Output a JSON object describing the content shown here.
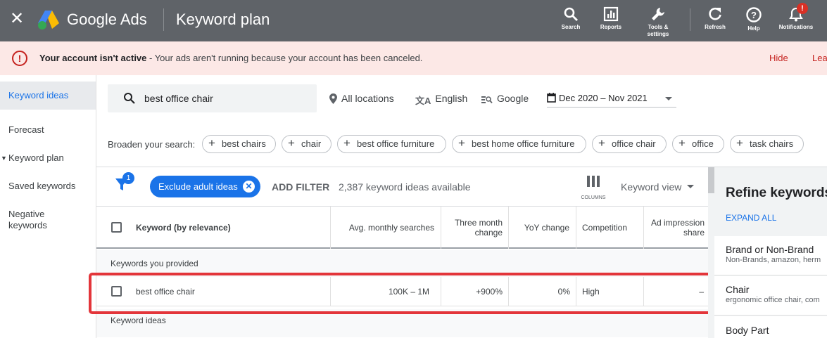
{
  "topbar": {
    "brand": "Google Ads",
    "page_title": "Keyword plan",
    "actions": [
      {
        "label": "Search",
        "icon": "search-icon"
      },
      {
        "label": "Reports",
        "icon": "reports-icon"
      },
      {
        "label": "Tools & settings",
        "icon": "wrench-icon"
      },
      {
        "label": "Refresh",
        "icon": "refresh-icon"
      },
      {
        "label": "Help",
        "icon": "help-icon"
      },
      {
        "label": "Notifications",
        "icon": "bell-icon",
        "badge": "!"
      }
    ]
  },
  "alert": {
    "title": "Your account isn't active",
    "message": " - Your ads aren't running because your account has been canceled.",
    "hide": "Hide",
    "learn": "Lea"
  },
  "sidebar": {
    "items": [
      {
        "label": "Keyword ideas",
        "active": true
      },
      {
        "label": "Forecast"
      },
      {
        "label": "Keyword plan",
        "expandable": true
      },
      {
        "label": "Saved keywords"
      },
      {
        "label": "Negative keywords"
      }
    ]
  },
  "search": {
    "query": "best office chair",
    "location": "All locations",
    "language": "English",
    "network": "Google",
    "date_range": "Dec 2020 – Nov 2021",
    "broaden_label": "Broaden your search:",
    "chips": [
      "best chairs",
      "chair",
      "best office furniture",
      "best home office furniture",
      "office chair",
      "office",
      "task chairs"
    ]
  },
  "filters": {
    "badge": "1",
    "active_filter": "Exclude adult ideas",
    "add_filter": "ADD FILTER",
    "count_text": "2,387 keyword ideas available",
    "columns_label": "COLUMNS",
    "view": "Keyword view"
  },
  "table": {
    "headers": [
      "Keyword (by relevance)",
      "Avg. monthly searches",
      "Three month change",
      "YoY change",
      "Competition",
      "Ad impression share"
    ],
    "group_provided": "Keywords you provided",
    "group_ideas": "Keyword ideas",
    "row": {
      "keyword": "best office chair",
      "avg_searches": "100K – 1M",
      "three_month": "+900%",
      "yoy": "0%",
      "competition": "High",
      "impression_share": "–"
    }
  },
  "refine": {
    "title": "Refine keywords",
    "expand": "EXPAND ALL",
    "items": [
      {
        "title": "Brand or Non-Brand",
        "sub": "Non-Brands, amazon, herm"
      },
      {
        "title": "Chair",
        "sub": "ergonomic office chair, com"
      },
      {
        "title": "Body Part",
        "sub": ""
      }
    ]
  },
  "colors": {
    "topbar": "#5f6368",
    "accent": "#1a73e8",
    "alert_bg": "#fce8e6",
    "alert_text": "#c5221f",
    "highlight": "#e3353a"
  }
}
